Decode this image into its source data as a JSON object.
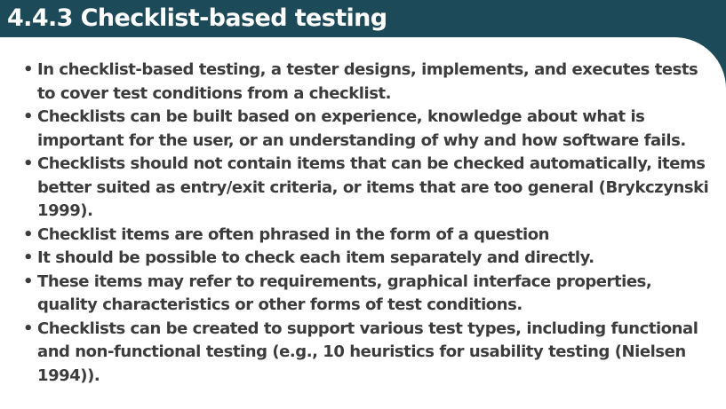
{
  "slide": {
    "title": "4.4.3 Checklist-based testing",
    "bullet_glyph": "•",
    "bullets": [
      "In checklist-based testing, a tester designs, implements, and executes tests to cover test conditions from a checklist.",
      "Checklists can be built based on experience, knowledge about what is important for the user, or an understanding of why and how software fails.",
      "Checklists should not contain items that can be checked automatically, items better suited as entry/exit criteria, or items that are too general (Brykczynski 1999).",
      "Checklist items are often phrased in the form of a question",
      " It should be possible to check each item separately and directly.",
      "These items may refer to requirements, graphical interface properties, quality characteristics or other forms of test conditions.",
      "Checklists can be created to support various test types, including functional and non-functional testing (e.g., 10 heuristics for usability testing (Nielsen 1994))."
    ]
  },
  "colors": {
    "header_background": "#1d4a58",
    "title_text": "#ffffff",
    "body_text": "#3c3c3c",
    "panel_background": "#ffffff"
  }
}
